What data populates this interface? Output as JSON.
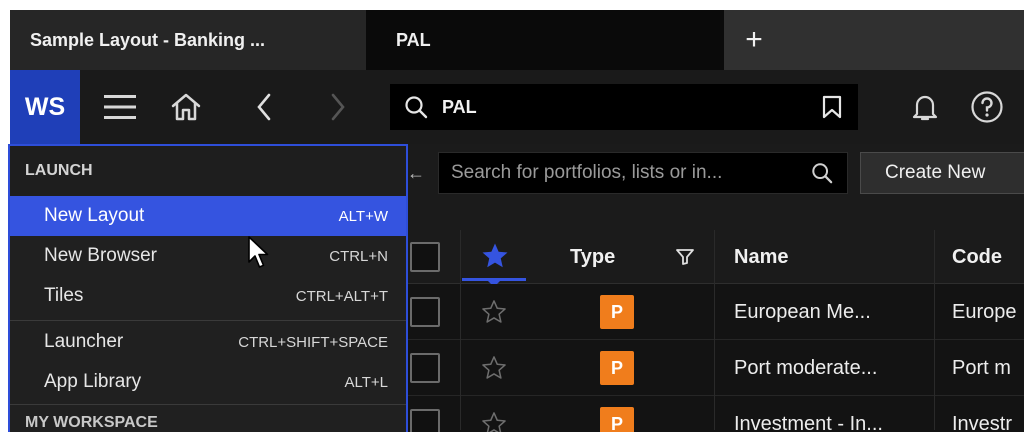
{
  "tabs": [
    {
      "label": "Sample Layout - Banking ..."
    },
    {
      "label": "PAL"
    }
  ],
  "tab_add_label": "+",
  "toolbar": {
    "ws_label": "WS",
    "search_query": "PAL"
  },
  "filter": {
    "placeholder": "Search for portfolios, lists or in..."
  },
  "create_label": "Create New",
  "table": {
    "headers": {
      "type": "Type",
      "name": "Name",
      "code": "Code"
    },
    "rows": [
      {
        "badge": "P",
        "name": "European Me...",
        "code": "Europe"
      },
      {
        "badge": "P",
        "name": "Port moderate...",
        "code": "Port m"
      },
      {
        "badge": "P",
        "name": "Investment - In...",
        "code": "Investr"
      }
    ]
  },
  "menu": {
    "header": "LAUNCH",
    "items": [
      {
        "label": "New Layout",
        "shortcut": "ALT+W"
      },
      {
        "label": "New Browser",
        "shortcut": "CTRL+N"
      },
      {
        "label": "Tiles",
        "shortcut": "CTRL+ALT+T"
      },
      {
        "label": "Launcher",
        "shortcut": "CTRL+SHIFT+SPACE"
      },
      {
        "label": "App Library",
        "shortcut": "ALT+L"
      }
    ],
    "sub_header": "MY WORKSPACE"
  },
  "colors": {
    "accent": "#3554e0",
    "brand": "#1f3fb8",
    "badge": "#f07d1c"
  }
}
